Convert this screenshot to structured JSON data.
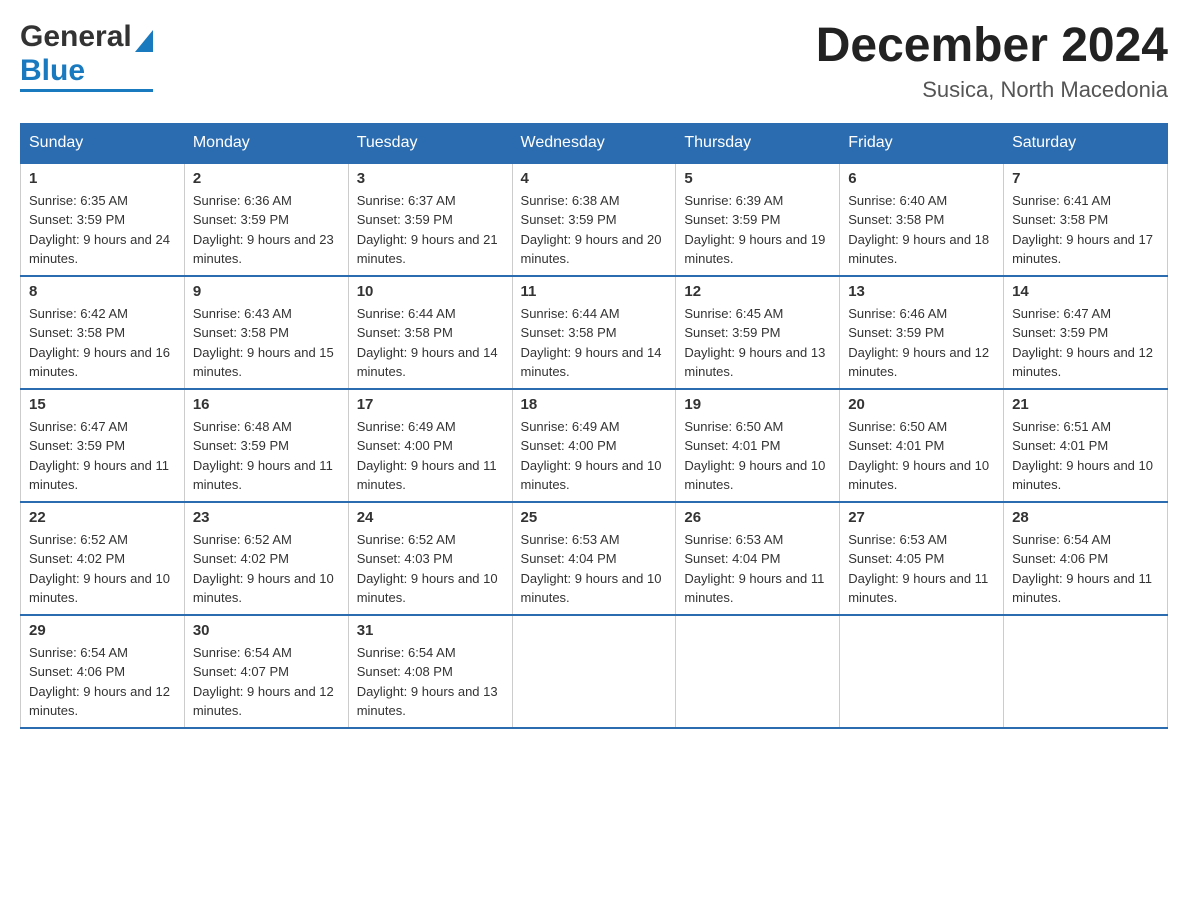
{
  "header": {
    "logo": {
      "general": "General",
      "blue": "Blue",
      "arrow_symbol": "▶"
    },
    "title": "December 2024",
    "location": "Susica, North Macedonia"
  },
  "calendar": {
    "days_of_week": [
      "Sunday",
      "Monday",
      "Tuesday",
      "Wednesday",
      "Thursday",
      "Friday",
      "Saturday"
    ],
    "weeks": [
      [
        {
          "day": "1",
          "sunrise": "6:35 AM",
          "sunset": "3:59 PM",
          "daylight": "9 hours and 24 minutes."
        },
        {
          "day": "2",
          "sunrise": "6:36 AM",
          "sunset": "3:59 PM",
          "daylight": "9 hours and 23 minutes."
        },
        {
          "day": "3",
          "sunrise": "6:37 AM",
          "sunset": "3:59 PM",
          "daylight": "9 hours and 21 minutes."
        },
        {
          "day": "4",
          "sunrise": "6:38 AM",
          "sunset": "3:59 PM",
          "daylight": "9 hours and 20 minutes."
        },
        {
          "day": "5",
          "sunrise": "6:39 AM",
          "sunset": "3:59 PM",
          "daylight": "9 hours and 19 minutes."
        },
        {
          "day": "6",
          "sunrise": "6:40 AM",
          "sunset": "3:58 PM",
          "daylight": "9 hours and 18 minutes."
        },
        {
          "day": "7",
          "sunrise": "6:41 AM",
          "sunset": "3:58 PM",
          "daylight": "9 hours and 17 minutes."
        }
      ],
      [
        {
          "day": "8",
          "sunrise": "6:42 AM",
          "sunset": "3:58 PM",
          "daylight": "9 hours and 16 minutes."
        },
        {
          "day": "9",
          "sunrise": "6:43 AM",
          "sunset": "3:58 PM",
          "daylight": "9 hours and 15 minutes."
        },
        {
          "day": "10",
          "sunrise": "6:44 AM",
          "sunset": "3:58 PM",
          "daylight": "9 hours and 14 minutes."
        },
        {
          "day": "11",
          "sunrise": "6:44 AM",
          "sunset": "3:58 PM",
          "daylight": "9 hours and 14 minutes."
        },
        {
          "day": "12",
          "sunrise": "6:45 AM",
          "sunset": "3:59 PM",
          "daylight": "9 hours and 13 minutes."
        },
        {
          "day": "13",
          "sunrise": "6:46 AM",
          "sunset": "3:59 PM",
          "daylight": "9 hours and 12 minutes."
        },
        {
          "day": "14",
          "sunrise": "6:47 AM",
          "sunset": "3:59 PM",
          "daylight": "9 hours and 12 minutes."
        }
      ],
      [
        {
          "day": "15",
          "sunrise": "6:47 AM",
          "sunset": "3:59 PM",
          "daylight": "9 hours and 11 minutes."
        },
        {
          "day": "16",
          "sunrise": "6:48 AM",
          "sunset": "3:59 PM",
          "daylight": "9 hours and 11 minutes."
        },
        {
          "day": "17",
          "sunrise": "6:49 AM",
          "sunset": "4:00 PM",
          "daylight": "9 hours and 11 minutes."
        },
        {
          "day": "18",
          "sunrise": "6:49 AM",
          "sunset": "4:00 PM",
          "daylight": "9 hours and 10 minutes."
        },
        {
          "day": "19",
          "sunrise": "6:50 AM",
          "sunset": "4:01 PM",
          "daylight": "9 hours and 10 minutes."
        },
        {
          "day": "20",
          "sunrise": "6:50 AM",
          "sunset": "4:01 PM",
          "daylight": "9 hours and 10 minutes."
        },
        {
          "day": "21",
          "sunrise": "6:51 AM",
          "sunset": "4:01 PM",
          "daylight": "9 hours and 10 minutes."
        }
      ],
      [
        {
          "day": "22",
          "sunrise": "6:52 AM",
          "sunset": "4:02 PM",
          "daylight": "9 hours and 10 minutes."
        },
        {
          "day": "23",
          "sunrise": "6:52 AM",
          "sunset": "4:02 PM",
          "daylight": "9 hours and 10 minutes."
        },
        {
          "day": "24",
          "sunrise": "6:52 AM",
          "sunset": "4:03 PM",
          "daylight": "9 hours and 10 minutes."
        },
        {
          "day": "25",
          "sunrise": "6:53 AM",
          "sunset": "4:04 PM",
          "daylight": "9 hours and 10 minutes."
        },
        {
          "day": "26",
          "sunrise": "6:53 AM",
          "sunset": "4:04 PM",
          "daylight": "9 hours and 11 minutes."
        },
        {
          "day": "27",
          "sunrise": "6:53 AM",
          "sunset": "4:05 PM",
          "daylight": "9 hours and 11 minutes."
        },
        {
          "day": "28",
          "sunrise": "6:54 AM",
          "sunset": "4:06 PM",
          "daylight": "9 hours and 11 minutes."
        }
      ],
      [
        {
          "day": "29",
          "sunrise": "6:54 AM",
          "sunset": "4:06 PM",
          "daylight": "9 hours and 12 minutes."
        },
        {
          "day": "30",
          "sunrise": "6:54 AM",
          "sunset": "4:07 PM",
          "daylight": "9 hours and 12 minutes."
        },
        {
          "day": "31",
          "sunrise": "6:54 AM",
          "sunset": "4:08 PM",
          "daylight": "9 hours and 13 minutes."
        },
        null,
        null,
        null,
        null
      ]
    ]
  }
}
